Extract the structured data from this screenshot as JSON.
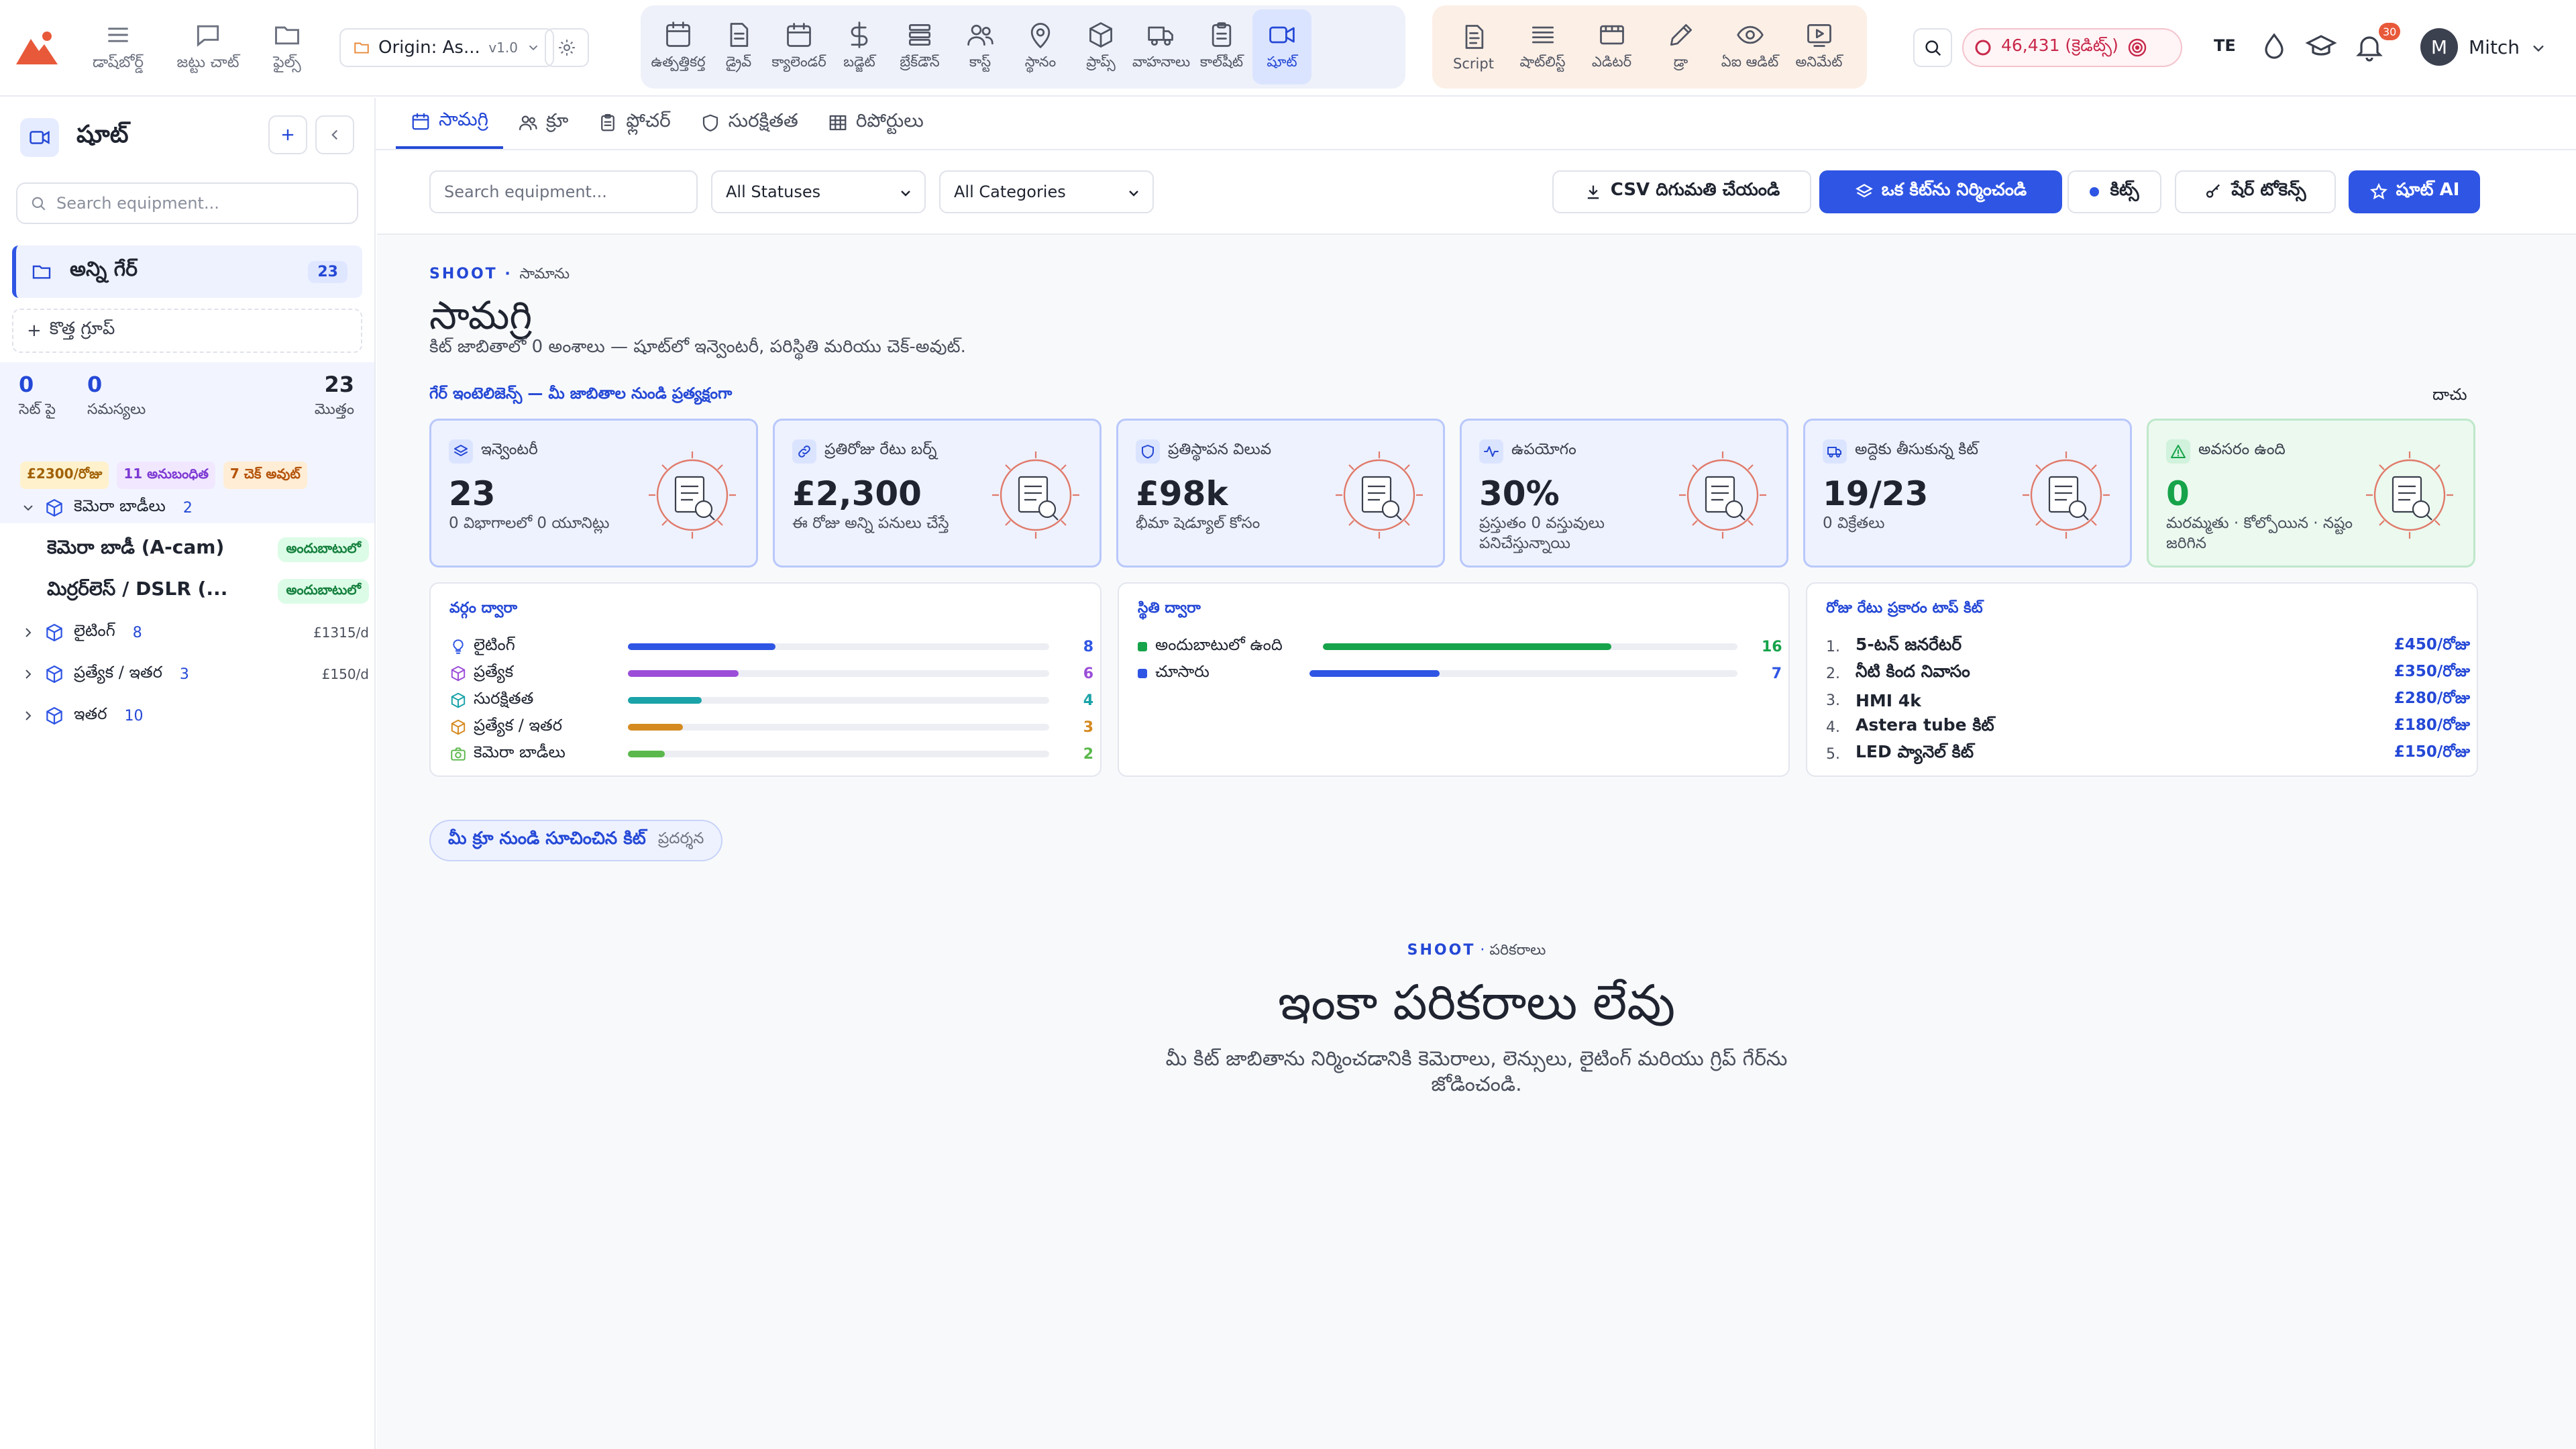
{
  "topbar": {
    "left_nav": [
      {
        "label": "డాష్‌బోర్డ్",
        "icon": "menu-icon"
      },
      {
        "label": "జట్టు చాట్",
        "icon": "chat-icon"
      },
      {
        "label": "ఫైల్స్",
        "icon": "folder-icon"
      }
    ],
    "project": {
      "name": "Origin: As...",
      "version": "v1.0"
    },
    "main_nav": [
      {
        "label": "ఉత్పత్తికర్త",
        "icon": "calendar-board-icon"
      },
      {
        "label": "డ్రైవ్",
        "icon": "document-icon"
      },
      {
        "label": "క్యాలెండర్",
        "icon": "calendar-icon"
      },
      {
        "label": "బడ్జెట్",
        "icon": "dollar-icon"
      },
      {
        "label": "బ్రేక్‌డౌన్",
        "icon": "stack-icon"
      },
      {
        "label": "కాస్ట్",
        "icon": "users-icon"
      },
      {
        "label": "స్థానం",
        "icon": "pin-icon"
      },
      {
        "label": "ప్రాప్స్",
        "icon": "box-icon"
      },
      {
        "label": "వాహనాలు",
        "icon": "truck-icon"
      },
      {
        "label": "కాల్‌షీట్",
        "icon": "clipboard-icon"
      },
      {
        "label": "షూట్",
        "icon": "video-icon"
      }
    ],
    "active_main": "షూట్",
    "sec_nav": [
      {
        "label": "Script",
        "icon": "script-icon"
      },
      {
        "label": "షాట్‌లిస్ట్",
        "icon": "list-icon"
      },
      {
        "label": "ఎడిటర్",
        "icon": "film-icon"
      },
      {
        "label": "డ్రా",
        "icon": "pencil-icon"
      },
      {
        "label": "ఏఐ ఆడిట్",
        "icon": "eye-icon"
      },
      {
        "label": "అనిమేట్",
        "icon": "play-icon"
      }
    ],
    "credits": "46,431 (క్రెడిట్స్)",
    "lang": "TE",
    "notif_count": "30",
    "user": {
      "initial": "M",
      "name": "Mitch"
    }
  },
  "sidebar": {
    "title": "షూట్",
    "search_placeholder": "Search equipment...",
    "all_gear": {
      "label": "అన్ని గేర్",
      "count": "23"
    },
    "new_group": "కొత్త గ్రూప్",
    "stats": [
      {
        "value": "0",
        "label": "సెట్ పై"
      },
      {
        "value": "0",
        "label": "సమస్యలు"
      },
      {
        "value": "23",
        "label": "మొత్తం"
      }
    ],
    "tags": [
      "£2300/రోజు",
      "11 అనుబంధిత",
      "7 చెక్ అవుట్"
    ],
    "tree": [
      {
        "label": "కెమెరా బాడీలు",
        "count": "2",
        "expanded": true,
        "rate": "",
        "children": [
          {
            "label": "కెమెరా బాడీ (A-cam)",
            "status": "అందుబాటులో"
          },
          {
            "label": "మిర్రర్‌లెస్ / DSLR (...",
            "status": "అందుబాటులో"
          }
        ]
      },
      {
        "label": "లైటింగ్",
        "count": "8",
        "expanded": false,
        "rate": "£1315/d",
        "children": []
      },
      {
        "label": "ప్రత్యేక / ఇతర",
        "count": "3",
        "expanded": false,
        "rate": "£150/d",
        "children": []
      },
      {
        "label": "ఇతర",
        "count": "10",
        "expanded": false,
        "rate": "",
        "children": []
      }
    ]
  },
  "tabs": [
    {
      "label": "సామగ్రి",
      "icon": "calendar-icon",
      "active": true
    },
    {
      "label": "క్రూ",
      "icon": "users-icon",
      "active": false
    },
    {
      "label": "ఫ్లోచర్",
      "icon": "clipboard-icon",
      "active": false
    },
    {
      "label": "సురక్షితత",
      "icon": "shield-icon",
      "active": false
    },
    {
      "label": "రిపోర్టులు",
      "icon": "grid-icon",
      "active": false
    }
  ],
  "filters": {
    "search_placeholder": "Search equipment...",
    "status": "All Statuses",
    "category": "All Categories",
    "export": "CSV దిగుమతి చేయండి",
    "build_kit": "ఒక కిట్‌ను నిర్మించండి",
    "kits": "కిట్స్",
    "share": "షేర్ టోకెన్స్",
    "ai": "షూట్ AI"
  },
  "page": {
    "eyebrow": "SHOOT",
    "eyebrow_sub": "సామాను",
    "title": "సామగ్రి",
    "subtitle": "కిట్ జాబితాలో 0 అంశాలు — షూట్‌లో ఇన్వెంటరీ, పరిస్థితి మరియు చెక్-అవుట్.",
    "intel": "గేర్ ఇంటెలిజెన్స్ — మీ జాబితాల నుండి ప్రత్యక్షంగా",
    "hide": "దాచు"
  },
  "kpis": [
    {
      "title": "ఇన్వెంటరీ",
      "value": "23",
      "sub": "0 విభాగాలలో 0 యూనిట్లు",
      "icon": "layers-icon"
    },
    {
      "title": "ప్రతిరోజు రేటు బర్న్",
      "value": "£2,300",
      "sub": "ఈ రోజు అన్ని పనులు చేస్తే",
      "icon": "link-icon"
    },
    {
      "title": "ప్రతిస్థాపన విలువ",
      "value": "£98k",
      "sub": "భీమా షెడ్యూల్ కోసం",
      "icon": "shield-icon"
    },
    {
      "title": "ఉపయోగం",
      "value": "30%",
      "sub": "ప్రస్తుతం 0 వస్తువులు పనిచేస్తున్నాయి",
      "icon": "pulse-icon"
    },
    {
      "title": "అద్దెకు తీసుకున్న కిట్",
      "value": "19/23",
      "sub": "0 విక్రేతలు",
      "icon": "truck-icon"
    },
    {
      "title": "అవసరం ఉంది",
      "value": "0",
      "sub": "మరమ్మతు · కోల్పోయిన · నష్టం జరిగిన",
      "icon": "warning-icon"
    }
  ],
  "by_category": {
    "title": "వర్గం ద్వారా",
    "max": 8,
    "rows": [
      {
        "label": "లైటింగ్",
        "value": 8,
        "color": "#2f55e4",
        "icon": "bulb-icon"
      },
      {
        "label": "ప్రత్యేక",
        "value": 6,
        "color": "#9b4dd8",
        "icon": "cube-icon"
      },
      {
        "label": "సురక్షితత",
        "value": 4,
        "color": "#1aa3a8",
        "icon": "cube-icon"
      },
      {
        "label": "ప్రత్యేక / ఇతర",
        "value": 3,
        "color": "#d58a1f",
        "icon": "cube-icon"
      },
      {
        "label": "కెమెరా బాడీలు",
        "value": 2,
        "color": "#5bb84c",
        "icon": "camera-icon"
      }
    ]
  },
  "by_status": {
    "title": "స్థితి ద్వారా",
    "max": 23,
    "rows": [
      {
        "label": "అందుబాటులో ఉంది",
        "value": 16,
        "color": "#16a34a"
      },
      {
        "label": "చూసారు",
        "value": 7,
        "color": "#2f55e4"
      }
    ]
  },
  "top_kit": {
    "title": "రోజు రేటు ప్రకారం టాప్ కిట్",
    "rows": [
      {
        "rank": "1.",
        "name": "5-టన్ జనరేటర్",
        "rate": "£450/రోజు"
      },
      {
        "rank": "2.",
        "name": "నీటి కింద నివాసం",
        "rate": "£350/రోజు"
      },
      {
        "rank": "3.",
        "name": "HMI 4k",
        "rate": "£280/రోజు"
      },
      {
        "rank": "4.",
        "name": "Astera tube కిట్",
        "rate": "£180/రోజు"
      },
      {
        "rank": "5.",
        "name": "LED ప్యానెల్ కిట్",
        "rate": "£150/రోజు"
      }
    ]
  },
  "suggest": {
    "label": "మీ క్రూ నుండి సూచించిన కిట్",
    "preview": "ప్రదర్శన"
  },
  "empty": {
    "eyebrow": "SHOOT",
    "eyebrow_sub": "పరికరాలు",
    "title": "ఇంకా పరికరాలు లేవు",
    "sub": "మీ కిట్ జాబితాను నిర్మించడానికి కెమెరాలు, లెన్సులు, లైటింగ్ మరియు గ్రిప్ గేర్‌ను జోడించండి."
  },
  "colors": {
    "accent": "#2f55e4",
    "available": "#16a34a"
  }
}
